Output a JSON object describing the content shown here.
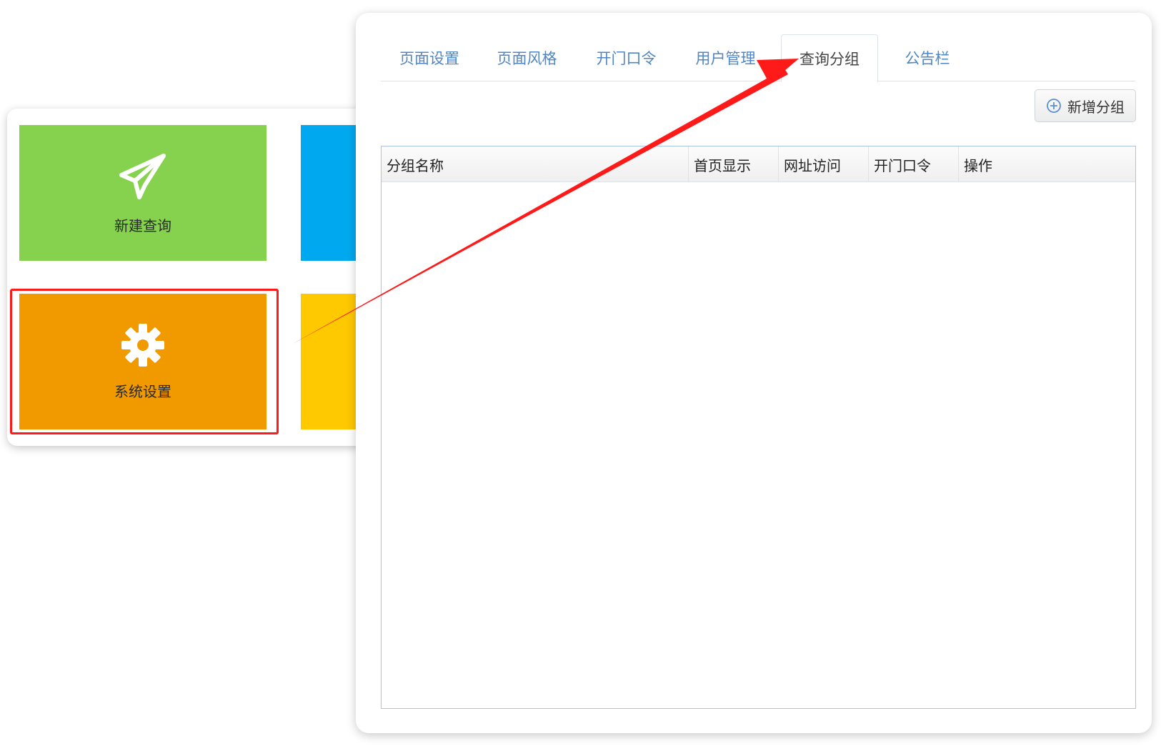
{
  "tiles": {
    "new_query_label": "新建查询",
    "settings_label": "系统设置",
    "colors": {
      "new_query": "#86d24e",
      "settings": "#f19a00",
      "blue": "#00a9ef",
      "yellow": "#ffc900"
    },
    "icons": {
      "new_query": "paper-plane-icon",
      "settings": "gear-icon"
    }
  },
  "tabs": [
    {
      "label": "页面设置",
      "active": false
    },
    {
      "label": "页面风格",
      "active": false
    },
    {
      "label": "开门口令",
      "active": false
    },
    {
      "label": "用户管理",
      "active": false
    },
    {
      "label": "查询分组",
      "active": true
    },
    {
      "label": "公告栏",
      "active": false
    }
  ],
  "toolbar": {
    "add_group_label": "新增分组",
    "add_icon": "plus-circle-icon"
  },
  "table": {
    "columns": [
      "分组名称",
      "首页显示",
      "网址访问",
      "开门口令",
      "操作"
    ],
    "rows": []
  },
  "annotation": {
    "highlight_color": "#ff1a1a",
    "arrow_color": "#ff1a1a"
  }
}
